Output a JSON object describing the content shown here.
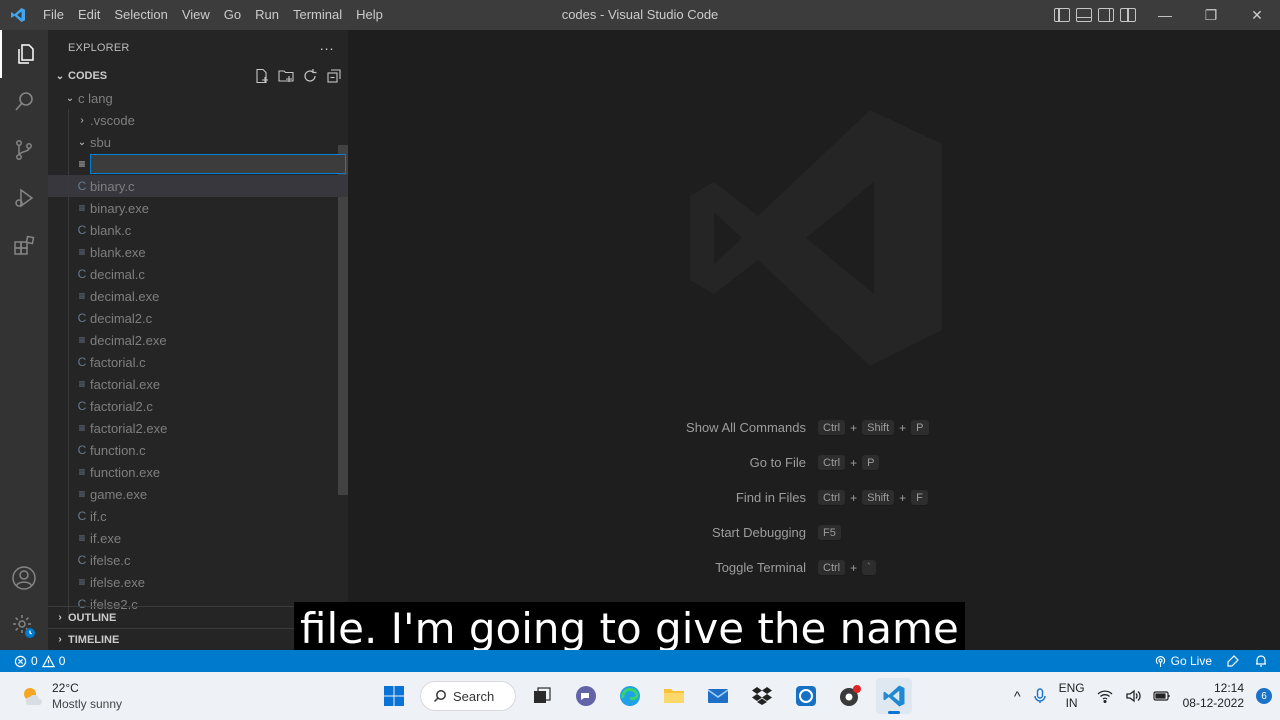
{
  "titlebar": {
    "menu": [
      "File",
      "Edit",
      "Selection",
      "View",
      "Go",
      "Run",
      "Terminal",
      "Help"
    ],
    "window_title": "codes - Visual Studio Code"
  },
  "sidebar": {
    "header": "EXPLORER",
    "more": "···",
    "section": "CODES",
    "tree": {
      "c_lang": "c lang",
      "vscode": ".vscode",
      "sbu": "sbu",
      "files": [
        {
          "name": "binary.c",
          "icon": "C"
        },
        {
          "name": "binary.exe",
          "icon": "≡"
        },
        {
          "name": "blank.c",
          "icon": "C"
        },
        {
          "name": "blank.exe",
          "icon": "≡"
        },
        {
          "name": "decimal.c",
          "icon": "C"
        },
        {
          "name": "decimal.exe",
          "icon": "≡"
        },
        {
          "name": "decimal2.c",
          "icon": "C"
        },
        {
          "name": "decimal2.exe",
          "icon": "≡"
        },
        {
          "name": "factorial.c",
          "icon": "C"
        },
        {
          "name": "factorial.exe",
          "icon": "≡"
        },
        {
          "name": "factorial2.c",
          "icon": "C"
        },
        {
          "name": "factorial2.exe",
          "icon": "≡"
        },
        {
          "name": "function.c",
          "icon": "C"
        },
        {
          "name": "function.exe",
          "icon": "≡"
        },
        {
          "name": "game.exe",
          "icon": "≡"
        },
        {
          "name": "if.c",
          "icon": "C"
        },
        {
          "name": "if.exe",
          "icon": "≡"
        },
        {
          "name": "ifelse.c",
          "icon": "C"
        },
        {
          "name": "ifelse.exe",
          "icon": "≡"
        },
        {
          "name": "ifelse2.c",
          "icon": "C"
        }
      ]
    },
    "outline": "OUTLINE",
    "timeline": "TIMELINE"
  },
  "editor": {
    "shortcuts": [
      {
        "label": "Show All Commands",
        "keys": [
          "Ctrl",
          "Shift",
          "P"
        ]
      },
      {
        "label": "Go to File",
        "keys": [
          "Ctrl",
          "P"
        ]
      },
      {
        "label": "Find in Files",
        "keys": [
          "Ctrl",
          "Shift",
          "F"
        ]
      },
      {
        "label": "Start Debugging",
        "keys": [
          "F5"
        ]
      },
      {
        "label": "Toggle Terminal",
        "keys": [
          "Ctrl",
          "`"
        ]
      }
    ],
    "caption": "file. I'm going to give the name"
  },
  "statusbar": {
    "errors": "0",
    "warnings": "0",
    "go_live": "Go Live"
  },
  "taskbar": {
    "temperature": "22°C",
    "weather": "Mostly sunny",
    "search": "Search",
    "lang1": "ENG",
    "lang2": "IN",
    "time": "12:14",
    "date": "08-12-2022",
    "notifications": "6"
  },
  "colors": {
    "accent": "#007acc",
    "activity_bar": "#333333",
    "sidebar": "#252526",
    "editor": "#1e1e1e"
  }
}
